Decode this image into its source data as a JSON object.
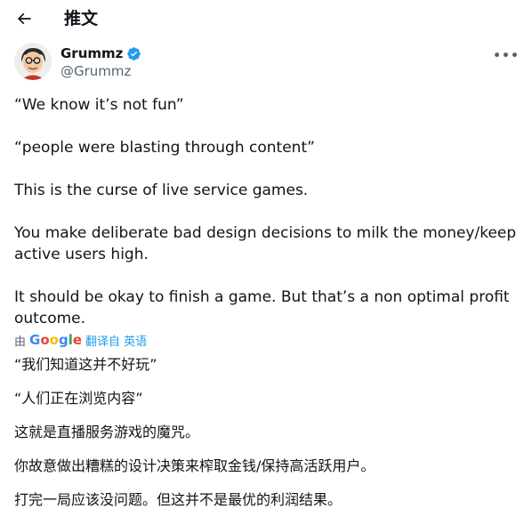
{
  "header": {
    "back_icon": "arrow-left-icon",
    "title": "推文"
  },
  "author": {
    "name": "Grummz",
    "handle": "@Grummz",
    "verified_icon": "verified-badge-icon",
    "verified_color": "#1d9bf0",
    "more_icon": "more-horizontal-icon",
    "more_label": "•••"
  },
  "tweet": {
    "lines": [
      "“We know it’s not fun”",
      "“people were blasting through content”",
      "This is the curse of live service games.",
      "You make deliberate bad design decisions to milk the money/keep active users high.",
      "It should be okay to finish a game. But that’s a non optimal profit outcome."
    ]
  },
  "translation": {
    "by_label": "由",
    "provider": "Google",
    "link_label": "翻译自 英语",
    "lines": [
      "“我们知道这并不好玩”",
      "“人们正在浏览内容”",
      "这就是直播服务游戏的魔咒。",
      "你故意做出糟糕的设计决策来榨取金钱/保持高活跃用户。",
      "打完一局应该没问题。但这并不是最优的利润结果。"
    ]
  },
  "colors": {
    "text": "#0f1419",
    "secondary": "#536471",
    "accent": "#1d9bf0"
  }
}
